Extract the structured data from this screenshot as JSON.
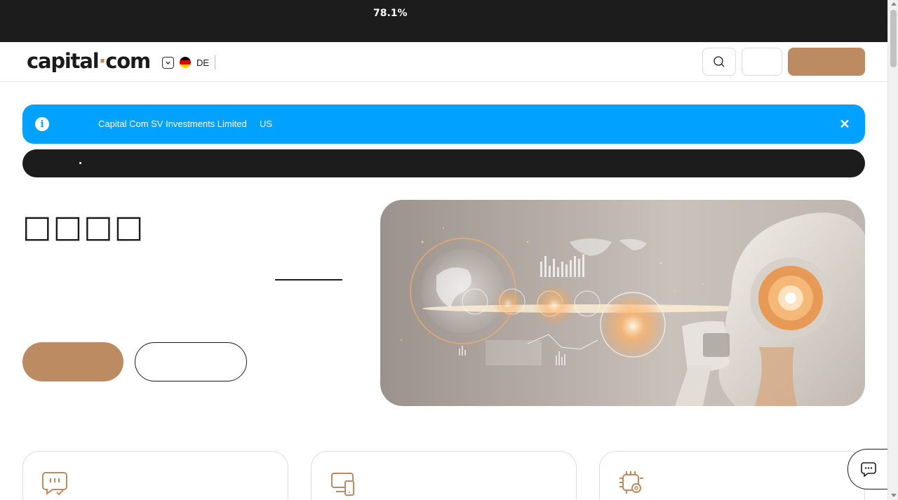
{
  "topbar": {
    "progress_text": "78.1%"
  },
  "header": {
    "logo_text_left": "capital",
    "logo_text_dot": "·",
    "logo_text_right": "com",
    "language_code": "DE",
    "icons": {
      "language_toggle": "chevron-down-icon",
      "flag": "germany-flag-icon",
      "search": "search-icon"
    }
  },
  "notice": {
    "entity_name": "Capital Com SV Investments Limited",
    "country": "US",
    "icons": {
      "info": "info-icon",
      "close": "close-icon"
    }
  },
  "hero": {
    "title": "□□□□",
    "image": "ai-robot-with-global-data-visualization"
  },
  "features": {
    "icons": [
      "chat-check-icon",
      "devices-icon",
      "chip-settings-icon"
    ]
  },
  "chat": {
    "icon": "chat-bubble-icon"
  },
  "colors": {
    "accent": "#bc8b62",
    "info_blue": "#00a1ff",
    "dark": "#1c1c1c"
  }
}
